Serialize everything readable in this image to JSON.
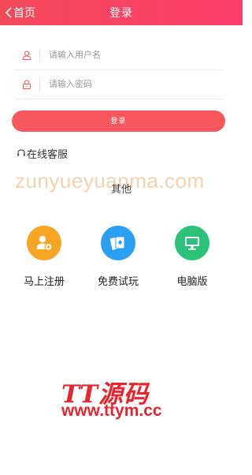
{
  "header": {
    "back_label": "首页",
    "title": "登录"
  },
  "form": {
    "username_placeholder": "请输入用户名",
    "password_placeholder": "请输入密码",
    "username_value": "",
    "password_value": ""
  },
  "login_button": "登录",
  "service_label": "在线客服",
  "watermark_text": "zunyueyuanma.com",
  "other_label": "其他",
  "options": [
    {
      "label": "马上注册",
      "icon": "add-user-icon",
      "color": "#f6a623"
    },
    {
      "label": "免费试玩",
      "icon": "playing-cards-icon",
      "color": "#2b9ff4"
    },
    {
      "label": "电脑版",
      "icon": "desktop-monitor-icon",
      "color": "#2cc27a"
    }
  ],
  "brand": {
    "logo_text": "TT源码",
    "url": "www.ttym.cc"
  },
  "colors": {
    "header": "#f34a59",
    "login_button": "#f7585d",
    "icon_red": "#f05b5b",
    "brand_red": "#e8252e"
  }
}
